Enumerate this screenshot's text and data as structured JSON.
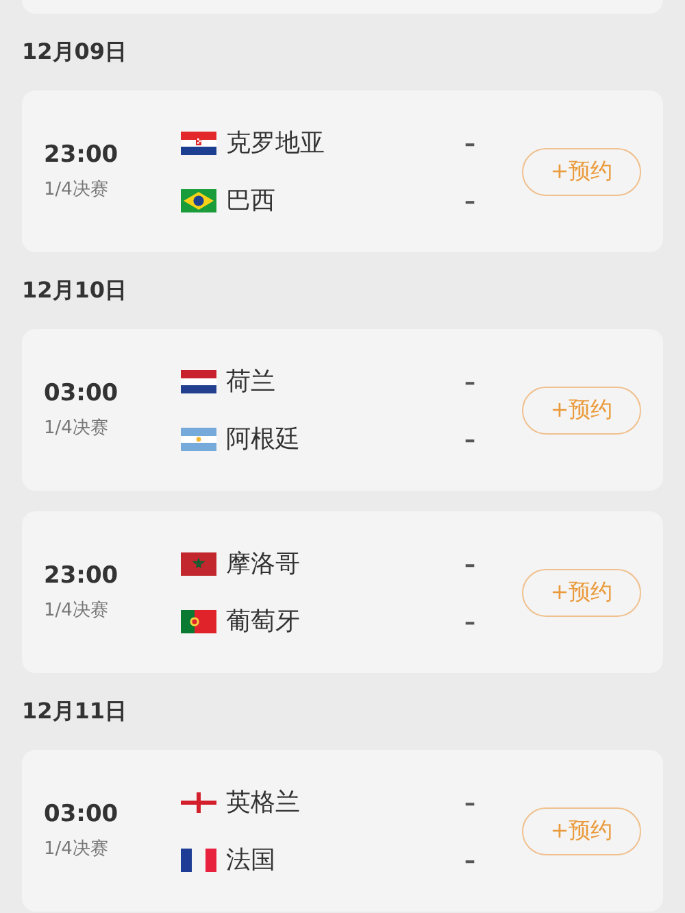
{
  "days": [
    {
      "date": "12月09日",
      "matches": [
        {
          "time": "23:00",
          "stage": "1/4决赛",
          "teams": [
            {
              "name": "克罗地亚",
              "kind": "croatia",
              "score": "–"
            },
            {
              "name": "巴西",
              "kind": "brazil",
              "score": "–"
            }
          ],
          "button": "+预约"
        }
      ]
    },
    {
      "date": "12月10日",
      "matches": [
        {
          "time": "03:00",
          "stage": "1/4决赛",
          "teams": [
            {
              "name": "荷兰",
              "kind": "netherlands",
              "score": "–"
            },
            {
              "name": "阿根廷",
              "kind": "argentina",
              "score": "–"
            }
          ],
          "button": "+预约"
        },
        {
          "time": "23:00",
          "stage": "1/4决赛",
          "teams": [
            {
              "name": "摩洛哥",
              "kind": "morocco",
              "score": "–"
            },
            {
              "name": "葡萄牙",
              "kind": "portugal",
              "score": "–"
            }
          ],
          "button": "+预约"
        }
      ]
    },
    {
      "date": "12月11日",
      "matches": [
        {
          "time": "03:00",
          "stage": "1/4决赛",
          "teams": [
            {
              "name": "英格兰",
              "kind": "england",
              "score": "–"
            },
            {
              "name": "法国",
              "kind": "france",
              "score": "–"
            }
          ],
          "button": "+预约"
        }
      ]
    }
  ]
}
